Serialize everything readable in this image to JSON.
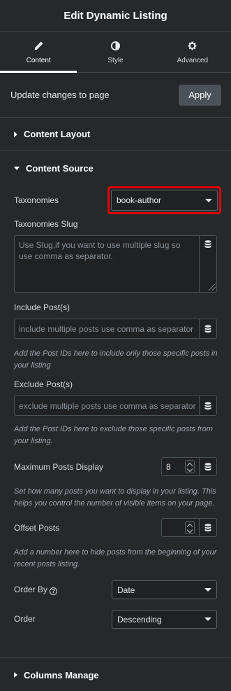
{
  "header": {
    "title": "Edit Dynamic Listing"
  },
  "tabs": [
    {
      "label": "Content",
      "icon": "pencil-icon",
      "active": true
    },
    {
      "label": "Style",
      "icon": "half-circle-icon",
      "active": false
    },
    {
      "label": "Advanced",
      "icon": "gear-icon",
      "active": false
    }
  ],
  "update": {
    "text": "Update changes to page",
    "apply_label": "Apply"
  },
  "sections": {
    "content_layout": "Content Layout",
    "content_source": "Content Source",
    "columns_manage": "Columns Manage"
  },
  "fields": {
    "taxonomies": {
      "label": "Taxonomies",
      "value": "book-author"
    },
    "taxonomies_slug": {
      "label": "Taxonomies Slug",
      "placeholder": "Use Slug,if you want to use multiple slug so use comma as separator."
    },
    "include_posts": {
      "label": "Include Post(s)",
      "placeholder": "include multiple posts use comma as separator",
      "description": "Add the Post IDs here to include only those specific posts in your listing"
    },
    "exclude_posts": {
      "label": "Exclude Post(s)",
      "placeholder": "exclude multiple posts use comma as separator",
      "description": "Add the Post IDs here to exclude those specific posts from your listing."
    },
    "max_posts": {
      "label": "Maximum Posts Display",
      "value": "8",
      "description": "Set how many posts you want to display in your listing. This helps you control the number of visible items on your page."
    },
    "offset_posts": {
      "label": "Offset Posts",
      "value": "",
      "description": "Add a number here to hide posts from the beginning of your recent posts listing."
    },
    "order_by": {
      "label": "Order By",
      "value": "Date"
    },
    "order": {
      "label": "Order",
      "value": "Descending"
    }
  },
  "colors": {
    "panel_bg": "#26292c",
    "highlight": "#e0000e",
    "apply_bg": "#4b5158"
  }
}
